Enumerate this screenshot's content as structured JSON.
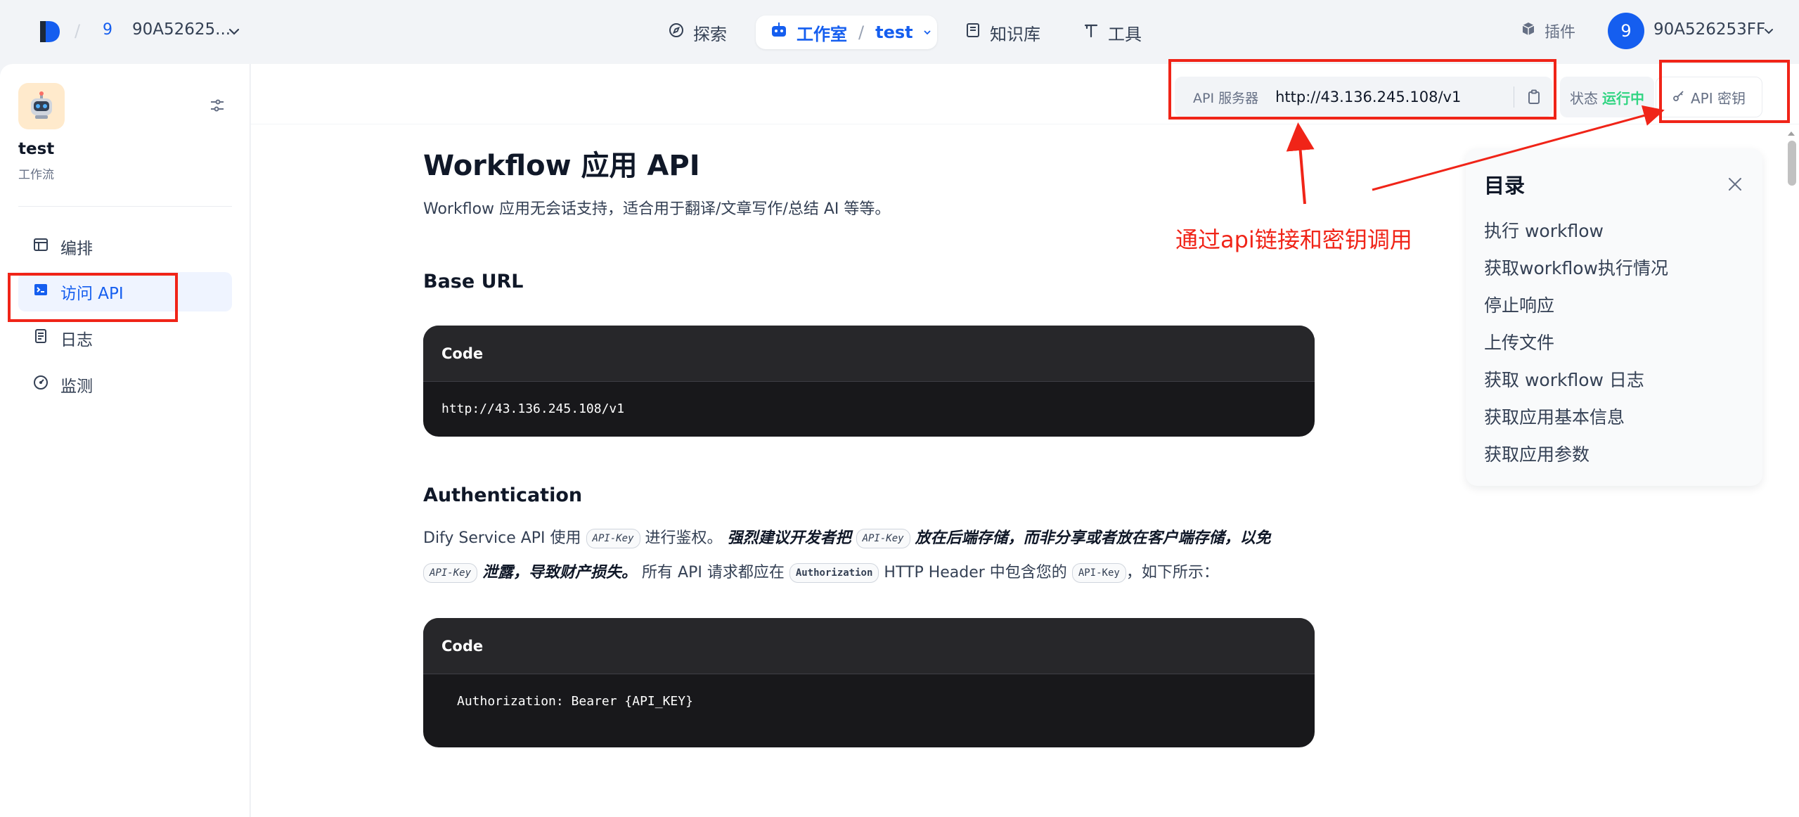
{
  "topnav": {
    "workspace_badge": "9",
    "workspace_name": "90A52625...",
    "explore_label": "探索",
    "studio_label": "工作室",
    "studio_app": "test",
    "knowledge_label": "知识库",
    "tools_label": "工具",
    "plugins_label": "插件",
    "avatar_initial": "9",
    "user_name": "90A526253FF"
  },
  "sidebar": {
    "app_name": "test",
    "app_type": "工作流",
    "items": [
      {
        "label": "编排",
        "icon": "layout-icon",
        "active": false
      },
      {
        "label": "访问 API",
        "icon": "terminal-icon",
        "active": true
      },
      {
        "label": "日志",
        "icon": "file-list-icon",
        "active": false
      },
      {
        "label": "监测",
        "icon": "dashboard-gauge-icon",
        "active": false
      }
    ]
  },
  "header": {
    "api_server_label": "API 服务器",
    "api_server_url": "http://43.136.245.108/v1",
    "status_label": "状态",
    "status_value": "运行中",
    "api_key_label": "API 密钥"
  },
  "doc": {
    "title": "Workflow 应用 API",
    "subtitle": "Workflow 应用无会话支持，适合用于翻译/文章写作/总结 AI 等等。",
    "base_url_heading": "Base URL",
    "code_label": "Code",
    "base_url_code": "http://43.136.245.108/v1",
    "auth_heading": "Authentication",
    "auth_para": {
      "t1": "Dify Service API 使用",
      "code1": "API-Key",
      "t2": "进行鉴权。",
      "strong1": "强烈建议开发者把",
      "code2": "API-Key",
      "strong2": "放在后端存储，而非分享或者放在客户端存储，以免",
      "code3": "API-Key",
      "strong3": "泄露，导致财产损失。",
      "t3": "所有 API 请求都应在",
      "code4": "Authorization",
      "t4": "HTTP Header 中包含您的",
      "code5": "API-Key",
      "t5": "，如下所示："
    },
    "auth_code": "Authorization: Bearer {API_KEY}"
  },
  "toc": {
    "title": "目录",
    "items": [
      "执行 workflow",
      "获取workflow执行情况",
      "停止响应",
      "上传文件",
      "获取 workflow 日志",
      "获取应用基本信息",
      "获取应用参数"
    ]
  },
  "annotation": {
    "text": "通过api链接和密钥调用",
    "color": "#f02418"
  },
  "colors": {
    "accent": "#155eef",
    "status_running": "#32d583",
    "code_bg": "#18181b"
  }
}
